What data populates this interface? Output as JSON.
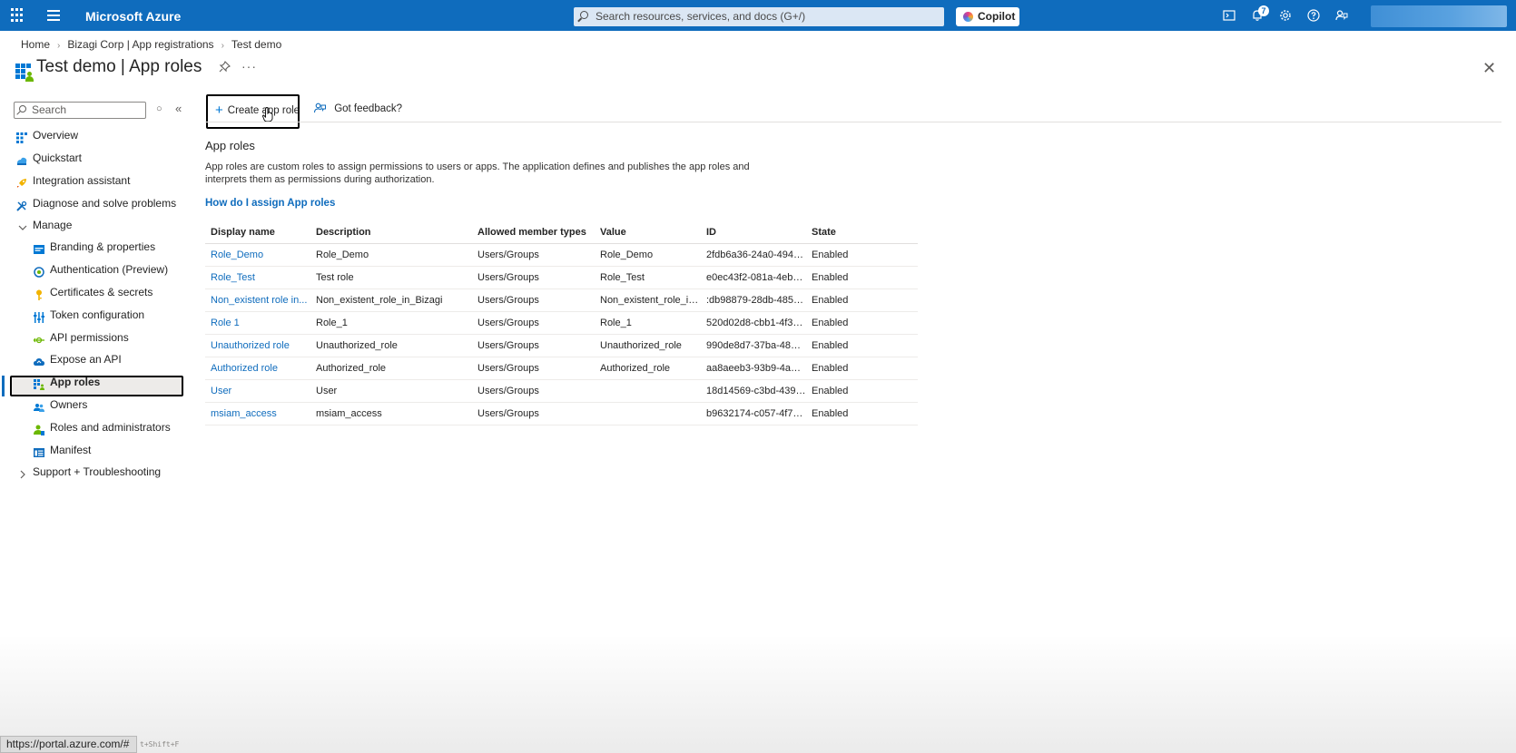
{
  "topbar": {
    "brand": "Microsoft Azure",
    "search_placeholder": "Search resources, services, and docs (G+/)",
    "copilot_label": "Copilot",
    "notification_count": "7",
    "icons": [
      "waffle-icon",
      "menu-icon",
      "terminal-icon",
      "bell-icon",
      "gear-icon",
      "help-icon",
      "feedback-icon"
    ]
  },
  "breadcrumb": [
    "Home",
    "Bizagi Corp | App registrations",
    "Test demo"
  ],
  "page": {
    "title": "Test demo | App roles"
  },
  "sidebar": {
    "search_placeholder": "Search",
    "items": [
      {
        "label": "Overview",
        "icon": "overview-icon"
      },
      {
        "label": "Quickstart",
        "icon": "quickstart-icon"
      },
      {
        "label": "Integration assistant",
        "icon": "rocket-icon"
      },
      {
        "label": "Diagnose and solve problems",
        "icon": "wrench-icon"
      },
      {
        "label": "Manage",
        "icon": "chevron-down-icon"
      },
      {
        "label": "Branding & properties",
        "icon": "branding-icon"
      },
      {
        "label": "Authentication (Preview)",
        "icon": "authentication-icon"
      },
      {
        "label": "Certificates & secrets",
        "icon": "key-icon"
      },
      {
        "label": "Token configuration",
        "icon": "token-icon"
      },
      {
        "label": "API permissions",
        "icon": "api-permissions-icon"
      },
      {
        "label": "Expose an API",
        "icon": "cloud-icon"
      },
      {
        "label": "App roles",
        "icon": "app-roles-icon",
        "selected": true
      },
      {
        "label": "Owners",
        "icon": "owners-icon"
      },
      {
        "label": "Roles and administrators",
        "icon": "roles-admin-icon"
      },
      {
        "label": "Manifest",
        "icon": "manifest-icon"
      },
      {
        "label": "Support + Troubleshooting",
        "icon": "chevron-right-icon"
      }
    ]
  },
  "toolbar": {
    "create_label": "Create app role",
    "feedback_label": "Got feedback?"
  },
  "content": {
    "section_title": "App roles",
    "description": "App roles are custom roles to assign permissions to users or apps. The application defines and publishes the app roles and interprets them as permissions during authorization.",
    "howto_link": "How do I assign App roles"
  },
  "table": {
    "columns": [
      "Display name",
      "Description",
      "Allowed member types",
      "Value",
      "ID",
      "State"
    ],
    "rows": [
      [
        "Role_Demo",
        "Role_Demo",
        "Users/Groups",
        "Role_Demo",
        "2fdb6a36-24a0-494a-...",
        "Enabled"
      ],
      [
        "Role_Test",
        "Test role",
        "Users/Groups",
        "Role_Test",
        "e0ec43f2-081a-4eb2-...",
        "Enabled"
      ],
      [
        "Non_existent role in...",
        "Non_existent_role_in_Bizagi",
        "Users/Groups",
        "Non_existent_role_in...",
        ":db98879-28db-485f-...",
        "Enabled"
      ],
      [
        "Role 1",
        "Role_1",
        "Users/Groups",
        "Role_1",
        "520d02d8-cbb1-4f38-...",
        "Enabled"
      ],
      [
        "Unauthorized role",
        "Unauthorized_role",
        "Users/Groups",
        "Unauthorized_role",
        "990de8d7-37ba-4819-...",
        "Enabled"
      ],
      [
        "Authorized role",
        "Authorized_role",
        "Users/Groups",
        "Authorized_role",
        "aa8aeeb3-93b9-4a4f-...",
        "Enabled"
      ],
      [
        "User",
        "User",
        "Users/Groups",
        "",
        "18d14569-c3bd-439b-...",
        "Enabled"
      ],
      [
        "msiam_access",
        "msiam_access",
        "Users/Groups",
        "",
        "b9632174-c057-4f7e-...",
        "Enabled"
      ]
    ]
  },
  "statusbar": {
    "url": "https://portal.azure.com/#",
    "hint": "t+Shift+F"
  },
  "colors": {
    "brand": "#0f6cbd",
    "link": "#0f6cbd",
    "selected_bg": "#edebe9"
  }
}
